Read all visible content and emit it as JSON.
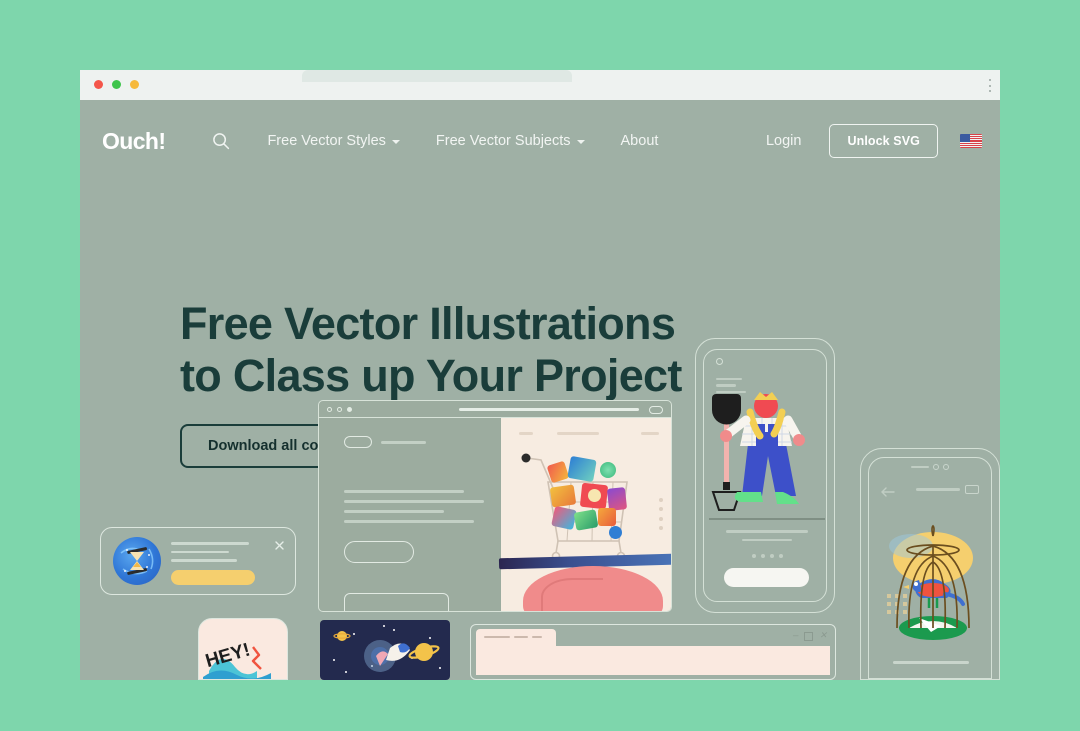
{
  "page": {
    "background_color": "#7ed6ac",
    "site_background": "#9fb0a5",
    "accent_dark": "#1a3d3a",
    "accent_yellow": "#f5cf6e"
  },
  "browser_chrome": {
    "traffic_lights": [
      "close",
      "minimize",
      "maximize"
    ],
    "menu_icon": "vertical-dots-icon",
    "tab_label": ""
  },
  "nav": {
    "logo": "Ouch!",
    "search_icon": "search-icon",
    "links": [
      {
        "label": "Free Vector Styles",
        "has_dropdown": true
      },
      {
        "label": "Free Vector Subjects",
        "has_dropdown": true
      },
      {
        "label": "About",
        "has_dropdown": false
      }
    ],
    "login_label": "Login",
    "unlock_label": "Unlock SVG",
    "flag_icon": "us-flag-icon"
  },
  "hero": {
    "heading_line1": "Free Vector Illustrations",
    "heading_line2": "to Class up Your Project",
    "cta_label": "Download all comps"
  },
  "illustrations": [
    {
      "name": "browser-mockup-shopping-cart",
      "caption": "Shopping cart with gift boxes on a tablet held by a hand"
    },
    {
      "name": "phone-mockup-gardener",
      "caption": "Gardener with shovel on a phone onboarding screen"
    },
    {
      "name": "phone-mockup-birdcage",
      "caption": "Bird in a cage illustration on a modern phone screen"
    },
    {
      "name": "notification-card-hourglass",
      "caption": "Notification card with hourglass icon and yellow button"
    },
    {
      "name": "hey-sticker-card",
      "caption": "HEY! sticker card"
    },
    {
      "name": "space-scene-card",
      "caption": "Space scene with planet and rocket"
    },
    {
      "name": "desktop-window-card",
      "caption": "Desktop window mockup with title bar controls"
    }
  ],
  "window_controls": {
    "minimize": "—",
    "maximize": "□",
    "close": "✕"
  }
}
